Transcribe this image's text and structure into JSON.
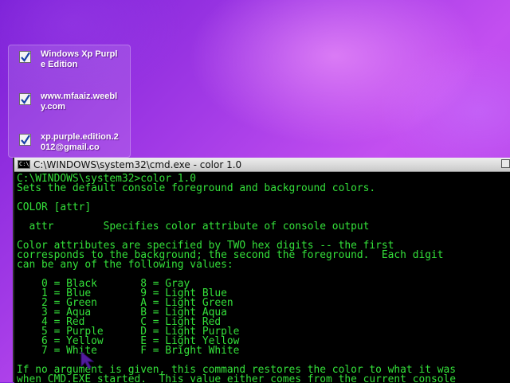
{
  "desktop": {
    "todo_items": [
      {
        "text": "Windows Xp Purple Edition",
        "checked": true
      },
      {
        "text": "www.mfaaiz.weebly.com",
        "checked": true
      },
      {
        "text": "xp.purple.edition.2012@gmail.co",
        "checked": true
      }
    ]
  },
  "window": {
    "title": "C:\\WINDOWS\\system32\\cmd.exe - color 1.0",
    "icon_label": "C:\\",
    "text_color": "#34e03a",
    "background_color": "#000000"
  },
  "console_lines": [
    "C:\\WINDOWS\\system32>color 1.0",
    "Sets the default console foreground and background colors.",
    "",
    "COLOR [attr]",
    "",
    "  attr        Specifies color attribute of console output",
    "",
    "Color attributes are specified by TWO hex digits -- the first",
    "corresponds to the background; the second the foreground.  Each digit",
    "can be any of the following values:",
    "",
    "    0 = Black       8 = Gray",
    "    1 = Blue        9 = Light Blue",
    "    2 = Green       A = Light Green",
    "    3 = Aqua        B = Light Aqua",
    "    4 = Red         C = Light Red",
    "    5 = Purple      D = Light Purple",
    "    6 = Yellow      E = Light Yellow",
    "    7 = White       F = Bright White",
    "",
    "If no argument is given, this command restores the color to what it was",
    "when CMD.EXE started.  This value either comes from the current console"
  ]
}
